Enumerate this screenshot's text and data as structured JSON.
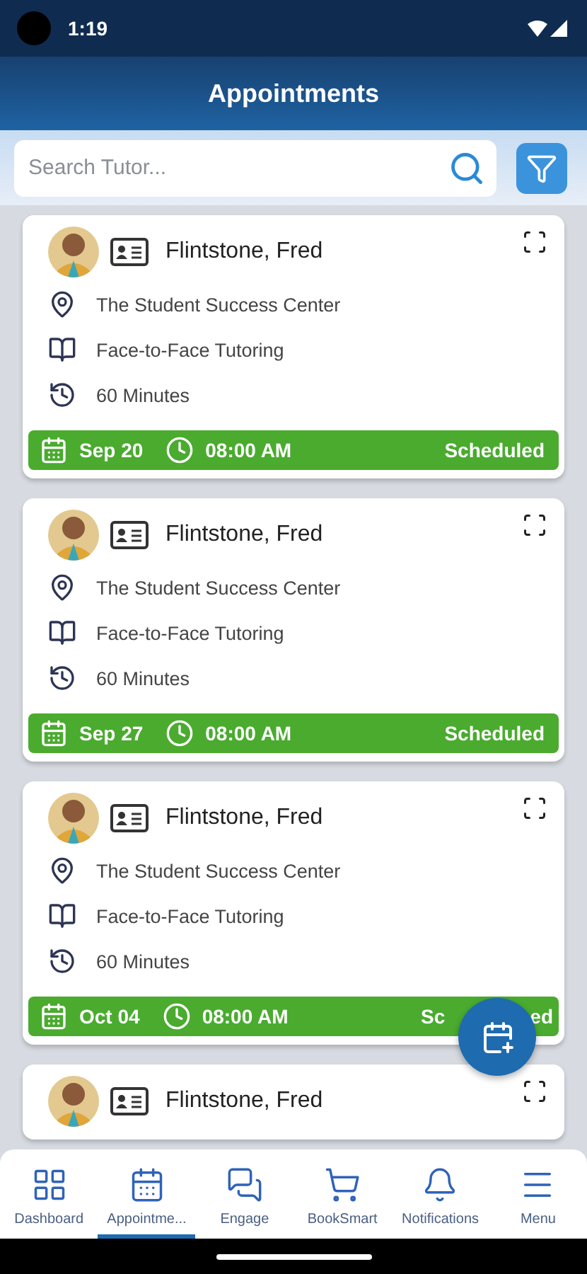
{
  "status_bar": {
    "time": "1:19"
  },
  "header": {
    "title": "Appointments"
  },
  "search": {
    "placeholder": "Search Tutor..."
  },
  "appointments": [
    {
      "tutor": "Flintstone, Fred",
      "location": "The Student Success Center",
      "type": "Face-to-Face Tutoring",
      "duration": "60 Minutes",
      "date": "Sep 20",
      "time": "08:00 AM",
      "status": "Scheduled"
    },
    {
      "tutor": "Flintstone, Fred",
      "location": "The Student Success Center",
      "type": "Face-to-Face Tutoring",
      "duration": "60 Minutes",
      "date": "Sep 27",
      "time": "08:00 AM",
      "status": "Scheduled"
    },
    {
      "tutor": "Flintstone, Fred",
      "location": "The Student Success Center",
      "type": "Face-to-Face Tutoring",
      "duration": "60 Minutes",
      "date": "Oct 04",
      "time": "08:00 AM",
      "status": "Sc",
      "status_end": "ed"
    },
    {
      "tutor": "Flintstone, Fred"
    }
  ],
  "nav": [
    {
      "label": "Dashboard",
      "selected": false
    },
    {
      "label": "Appointme...",
      "selected": true
    },
    {
      "label": "Engage",
      "selected": false
    },
    {
      "label": "BookSmart",
      "selected": false
    },
    {
      "label": "Notifications",
      "selected": false
    },
    {
      "label": "Menu",
      "selected": false
    }
  ]
}
